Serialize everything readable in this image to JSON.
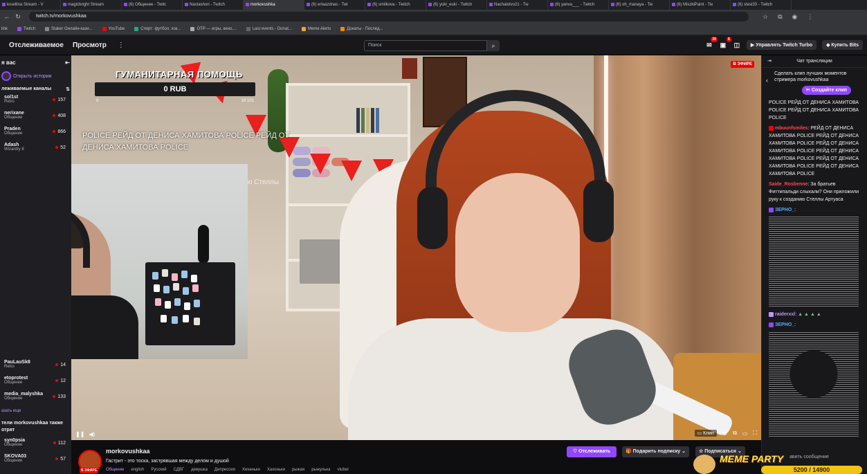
{
  "browser": {
    "tabs": [
      "kruellina Stream - V",
      "magicbright Stream",
      "(6) Общение - Twitc",
      "Nastashon - Twitch",
      "morkovushka",
      "(6) erlaazdnas - Twi",
      "(6) smilkova - Twitch",
      "(6) yuki_euki - Twitch",
      "Nachalotvo21 - Tw",
      "(6) yanva___ - Twitch",
      "(6) oh_manaya - Tw",
      "(6) MiszkiPaint - Tw",
      "(6) stesi33 - Twitch"
    ],
    "active_tab": 4,
    "url": "twitch.tv/morkovushkaa",
    "bookmarks": [
      "Twitch",
      "Staker Онлайн-кази...",
      "YouTube",
      "Спорт: футбол, хок...",
      "OTP — игры, кино,...",
      "Last events - Donat...",
      "Meme Alerts",
      "Донаты - Послед..."
    ],
    "bookmark_prefix": "link"
  },
  "topnav": {
    "following": "Отслеживаемое",
    "browse": "Просмотр",
    "more": "⋮",
    "search_placeholder": "Поиск",
    "inbox_badge": "30",
    "notif_badge": "6",
    "turbo": "Управлять Twitch Turbo",
    "bits": "Купить Bits"
  },
  "sidebar": {
    "header": "я вас",
    "story_link": "Открыть истории",
    "followed_title": "леживаемые каналы",
    "channels_top": [
      {
        "name": "sol1st",
        "game": "Retro",
        "viewers": "157"
      },
      {
        "name": "nerixane",
        "game": "Общение",
        "viewers": "408"
      },
      {
        "name": "Praden",
        "game": "Общение",
        "viewers": "866"
      },
      {
        "name": "Adash",
        "game": "Wizardry 8",
        "viewers": "52"
      }
    ],
    "channels_bottom": [
      {
        "name": "PauLauSk8",
        "game": "Retro",
        "viewers": "14"
      },
      {
        "name": "etoprotest",
        "game": "Общение",
        "viewers": "12"
      },
      {
        "name": "media_malyshka",
        "game": "Общение",
        "viewers": "133"
      }
    ],
    "show_more": "азать еще",
    "also_watch": "тели morkovushkaa также отрят",
    "channels_also": [
      {
        "name": "syn0psia",
        "game": "Общение",
        "viewers": "112"
      },
      {
        "name": "SKOVA03",
        "game": "Общение",
        "viewers": "57"
      }
    ]
  },
  "video": {
    "donate_title": "ГУМАНИТАРНАЯ ПОМОЩЬ",
    "donate_value": "0 RUB",
    "donate_min": "0",
    "donate_max": "10 101",
    "raid_text": "POLICE РЕЙД ОТ ДЕНИСА ХАМИТОВА POLICE РЕЙД ОТ ДЕНИСА ХАМИТОВА POLICE",
    "ghost_text": "ю Стеллы",
    "live": "В ЭФИРЕ",
    "clip": "Клип"
  },
  "info": {
    "streamer": "morkovushkaa",
    "avatar_live": "В ЭФИРЕ",
    "title": "Гастрит - это тоска, застрявшая между делом и душой",
    "category": "Общение",
    "tags": [
      "english",
      "Русский",
      "СДВГ",
      "девушка",
      "Депрессия",
      "Хиханьки",
      "Хахоньки",
      "рыжая",
      "рыжулька",
      "vtuber"
    ],
    "follow": "Отслеживать",
    "gift": "Подарить подписку",
    "subscribe": "Подписаться"
  },
  "chat": {
    "header": "Чат трансляции",
    "clip_promo": "Сделать клип лучших моментов стримера morkovushkaa",
    "clip_create": "Создайте клип",
    "messages": [
      {
        "user": "",
        "text": "POLICE РЕЙД ОТ ДЕНИСА ХАМИТОВА POLICE РЕЙД ОТ ДЕНИСА ХАМИТОВА POLICE"
      },
      {
        "user": "mbuunfsmiles",
        "text": ": РЕЙД ОТ ДЕНИСА ХАМИТОВА POLICE РЕЙД ОТ ДЕНИСА ХАМИТОВА POLICE РЕЙД ОТ ДЕНИСА ХАМИТОВА POLICE РЕЙД ОТ ДЕНИСА ХАМИТОВА POLICE РЕЙД ОТ ДЕНИСА ХАМИТОВА POLICE РЕЙД ОТ ДЕНИСА ХАМИТОВА POLICE"
      },
      {
        "user": "Saide_Rosbenne",
        "text": ": За братьев Фиттипальди слыхали? Они приложили руку к созданию Стеллы Артуаса"
      },
      {
        "user": "ЗЕРНО_",
        "text": ":"
      },
      {
        "user": "raiderxxl",
        "text": ":"
      },
      {
        "user": "ЗЕРНО_",
        "text": ":"
      }
    ],
    "input_placeholder": "авить сообщение"
  },
  "meme_party": {
    "title": "MEME PARTY",
    "progress": "5200 / 14900"
  }
}
